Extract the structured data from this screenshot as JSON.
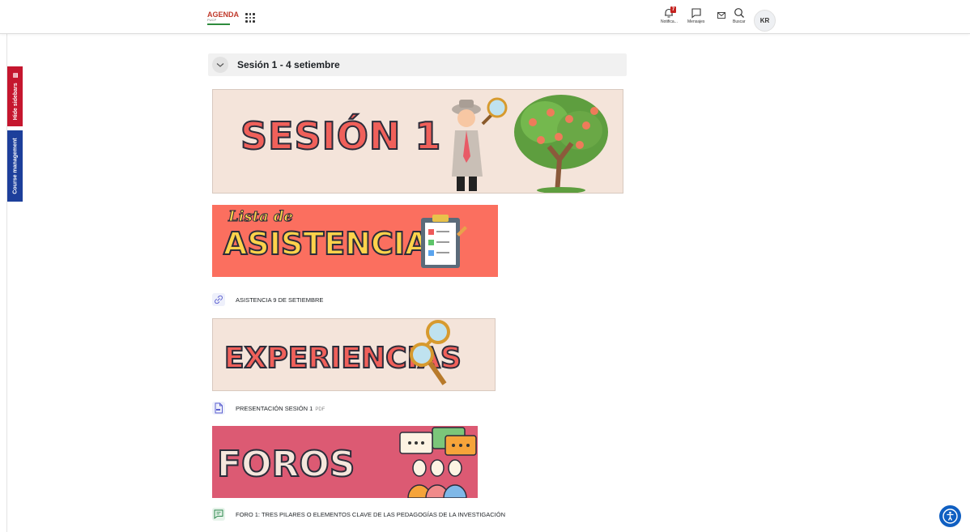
{
  "navbar": {
    "logo_text": "AGENDA",
    "logo_sub": "PUCP",
    "notifications_label": "Notifica...",
    "notifications_count": "7",
    "messages_label": "Mensajes",
    "search_label": "Buscar",
    "avatar_initials": "KR"
  },
  "sidebar_tabs": {
    "hide": "Hide sidebars",
    "course": "Course management"
  },
  "section": {
    "title": "Sesión 1 - 4 setiembre"
  },
  "banners": {
    "b1": "SESIÓN 1",
    "b2_script": "Lista de",
    "b2": "ASISTENCIA",
    "b3": "EXPERIENCIAS",
    "b4": "FOROS"
  },
  "activities": [
    {
      "name": "ASISTENCIA 9 DE SETIEMBRE",
      "type": "url",
      "icon": "link-icon"
    },
    {
      "name": "PRESENTACIÓN SESIÓN 1",
      "tag": "PDF",
      "type": "resource",
      "icon": "pdf-icon"
    },
    {
      "name": "FORO 1: TRES PILARES O ELEMENTOS CLAVE DE LAS PEDAGOGÍAS DE LA INVESTIGACIÓN",
      "type": "forum",
      "icon": "forum-icon"
    }
  ],
  "colors": {
    "hide_tab": "#c5162e",
    "course_tab": "#1d3f9b",
    "badge": "#c5221f",
    "accessibility": "#0f5fc2"
  }
}
